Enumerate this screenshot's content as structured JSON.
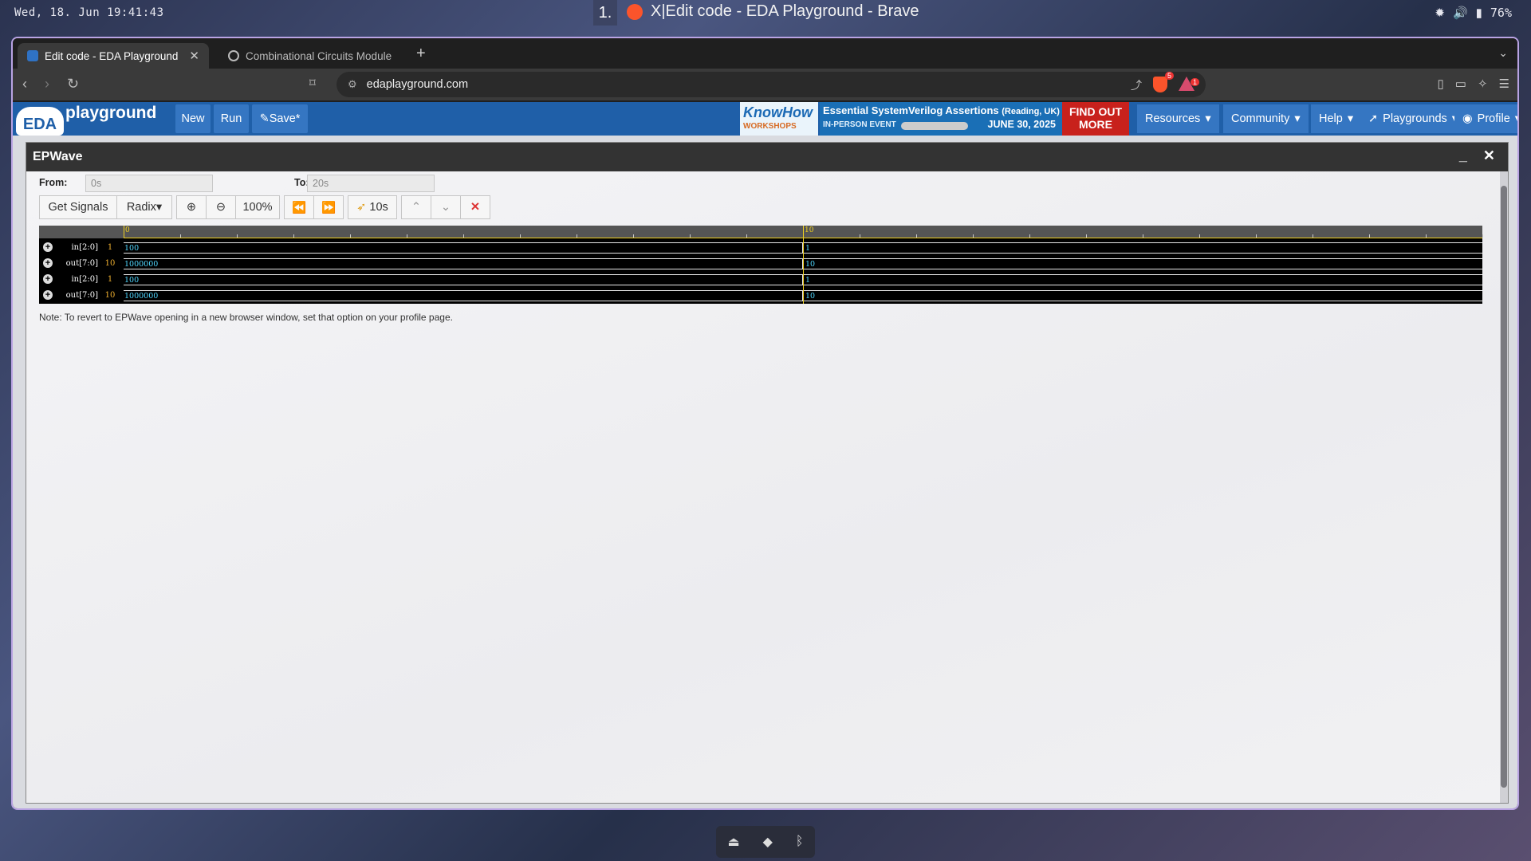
{
  "desktop": {
    "clock": "Wed, 18. Jun  19:41:43",
    "workspace": "1.",
    "window_title": "X|Edit code - EDA Playground - Brave",
    "battery": "76%"
  },
  "browser": {
    "tabs": [
      {
        "label": "Edit code - EDA Playground",
        "active": true
      },
      {
        "label": "Combinational Circuits Module",
        "active": false
      }
    ],
    "url": "edaplayground.com",
    "shield_badge": "5",
    "alert_badge": "1"
  },
  "eda": {
    "logo_eda": "EDA",
    "logo_playground": "playground",
    "buttons": {
      "new": "New",
      "run": "Run",
      "save": "Save*"
    },
    "banner": {
      "brand": "KnowHow",
      "brand_sub": "WORKSHOPS",
      "headline": "Essential SystemVerilog Assertions",
      "location": "(Reading, UK)",
      "event": "IN-PERSON EVENT",
      "date": "JUNE 30, 2025",
      "cta": "FIND OUT MORE"
    },
    "menus": {
      "resources": "Resources",
      "community": "Community",
      "help": "Help",
      "playgrounds": "Playgrounds",
      "profile": "Profile"
    }
  },
  "epwave": {
    "title": "EPWave",
    "from_label": "From:",
    "from_value": "0s",
    "to_label": "To:",
    "to_value": "20s",
    "toolbar": {
      "get_signals": "Get Signals",
      "radix": "Radix",
      "zoom": "100%",
      "cursor_time": "10s"
    },
    "ruler": {
      "start": "0",
      "mid": "10"
    },
    "signals": [
      {
        "name": "in[2:0]",
        "value": "1",
        "seg1": "100",
        "seg2": "1"
      },
      {
        "name": "out[7:0]",
        "value": "10",
        "seg1": "1000000",
        "seg2": "10"
      },
      {
        "name": "in[2:0]",
        "value": "1",
        "seg1": "100",
        "seg2": "1"
      },
      {
        "name": "out[7:0]",
        "value": "10",
        "seg1": "1000000",
        "seg2": "10"
      }
    ],
    "note": "Note: To revert to EPWave opening in a new browser window, set that option on your profile page."
  }
}
